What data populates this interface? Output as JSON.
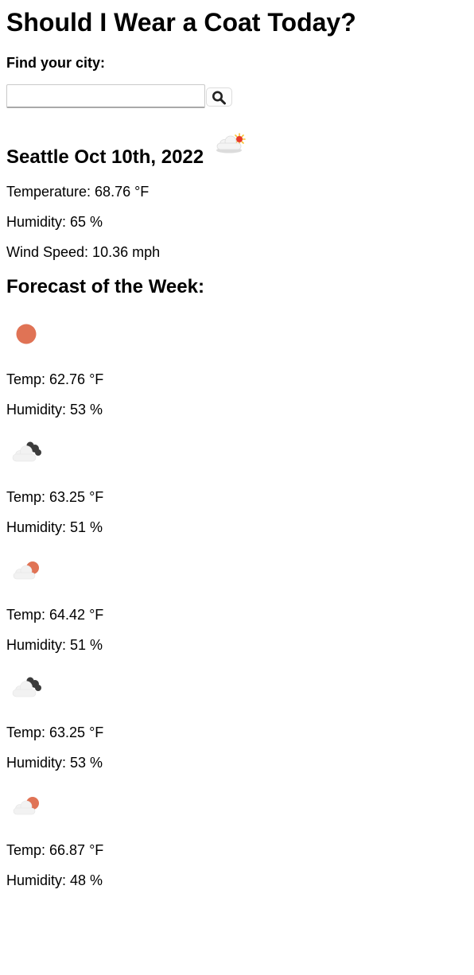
{
  "header": {
    "title": "Should I Wear a Coat Today?"
  },
  "search": {
    "label": "Find your city:",
    "value": "",
    "placeholder": "",
    "button_icon": "search-icon"
  },
  "current": {
    "city_date": "Seattle Oct 10th, 2022",
    "icon": "partly-cloudy-sun-icon",
    "temperature": "Temperature: 68.76 °F",
    "humidity": "Humidity: 65 %",
    "wind_speed": "Wind Speed: 10.36 mph"
  },
  "forecast": {
    "heading": "Forecast of the Week:",
    "days": [
      {
        "icon": "clear-night-icon",
        "temp": "Temp: 62.76 °F",
        "humidity": "Humidity: 53 %"
      },
      {
        "icon": "dark-clouds-icon",
        "temp": "Temp: 63.25 °F",
        "humidity": "Humidity: 51 %"
      },
      {
        "icon": "few-clouds-night-icon",
        "temp": "Temp: 64.42 °F",
        "humidity": "Humidity: 51 %"
      },
      {
        "icon": "dark-clouds-icon",
        "temp": "Temp: 63.25 °F",
        "humidity": "Humidity: 53 %"
      },
      {
        "icon": "few-clouds-night-icon",
        "temp": "Temp: 66.87 °F",
        "humidity": "Humidity: 48 %"
      }
    ]
  },
  "colors": {
    "text": "#000000",
    "background": "#ffffff",
    "accent_orange": "#e07355",
    "cloud_gray": "#f1f1f1",
    "dark_cloud": "#3c3c3c",
    "sun_red": "#e83a2a",
    "sun_yellow": "#f6c230"
  }
}
